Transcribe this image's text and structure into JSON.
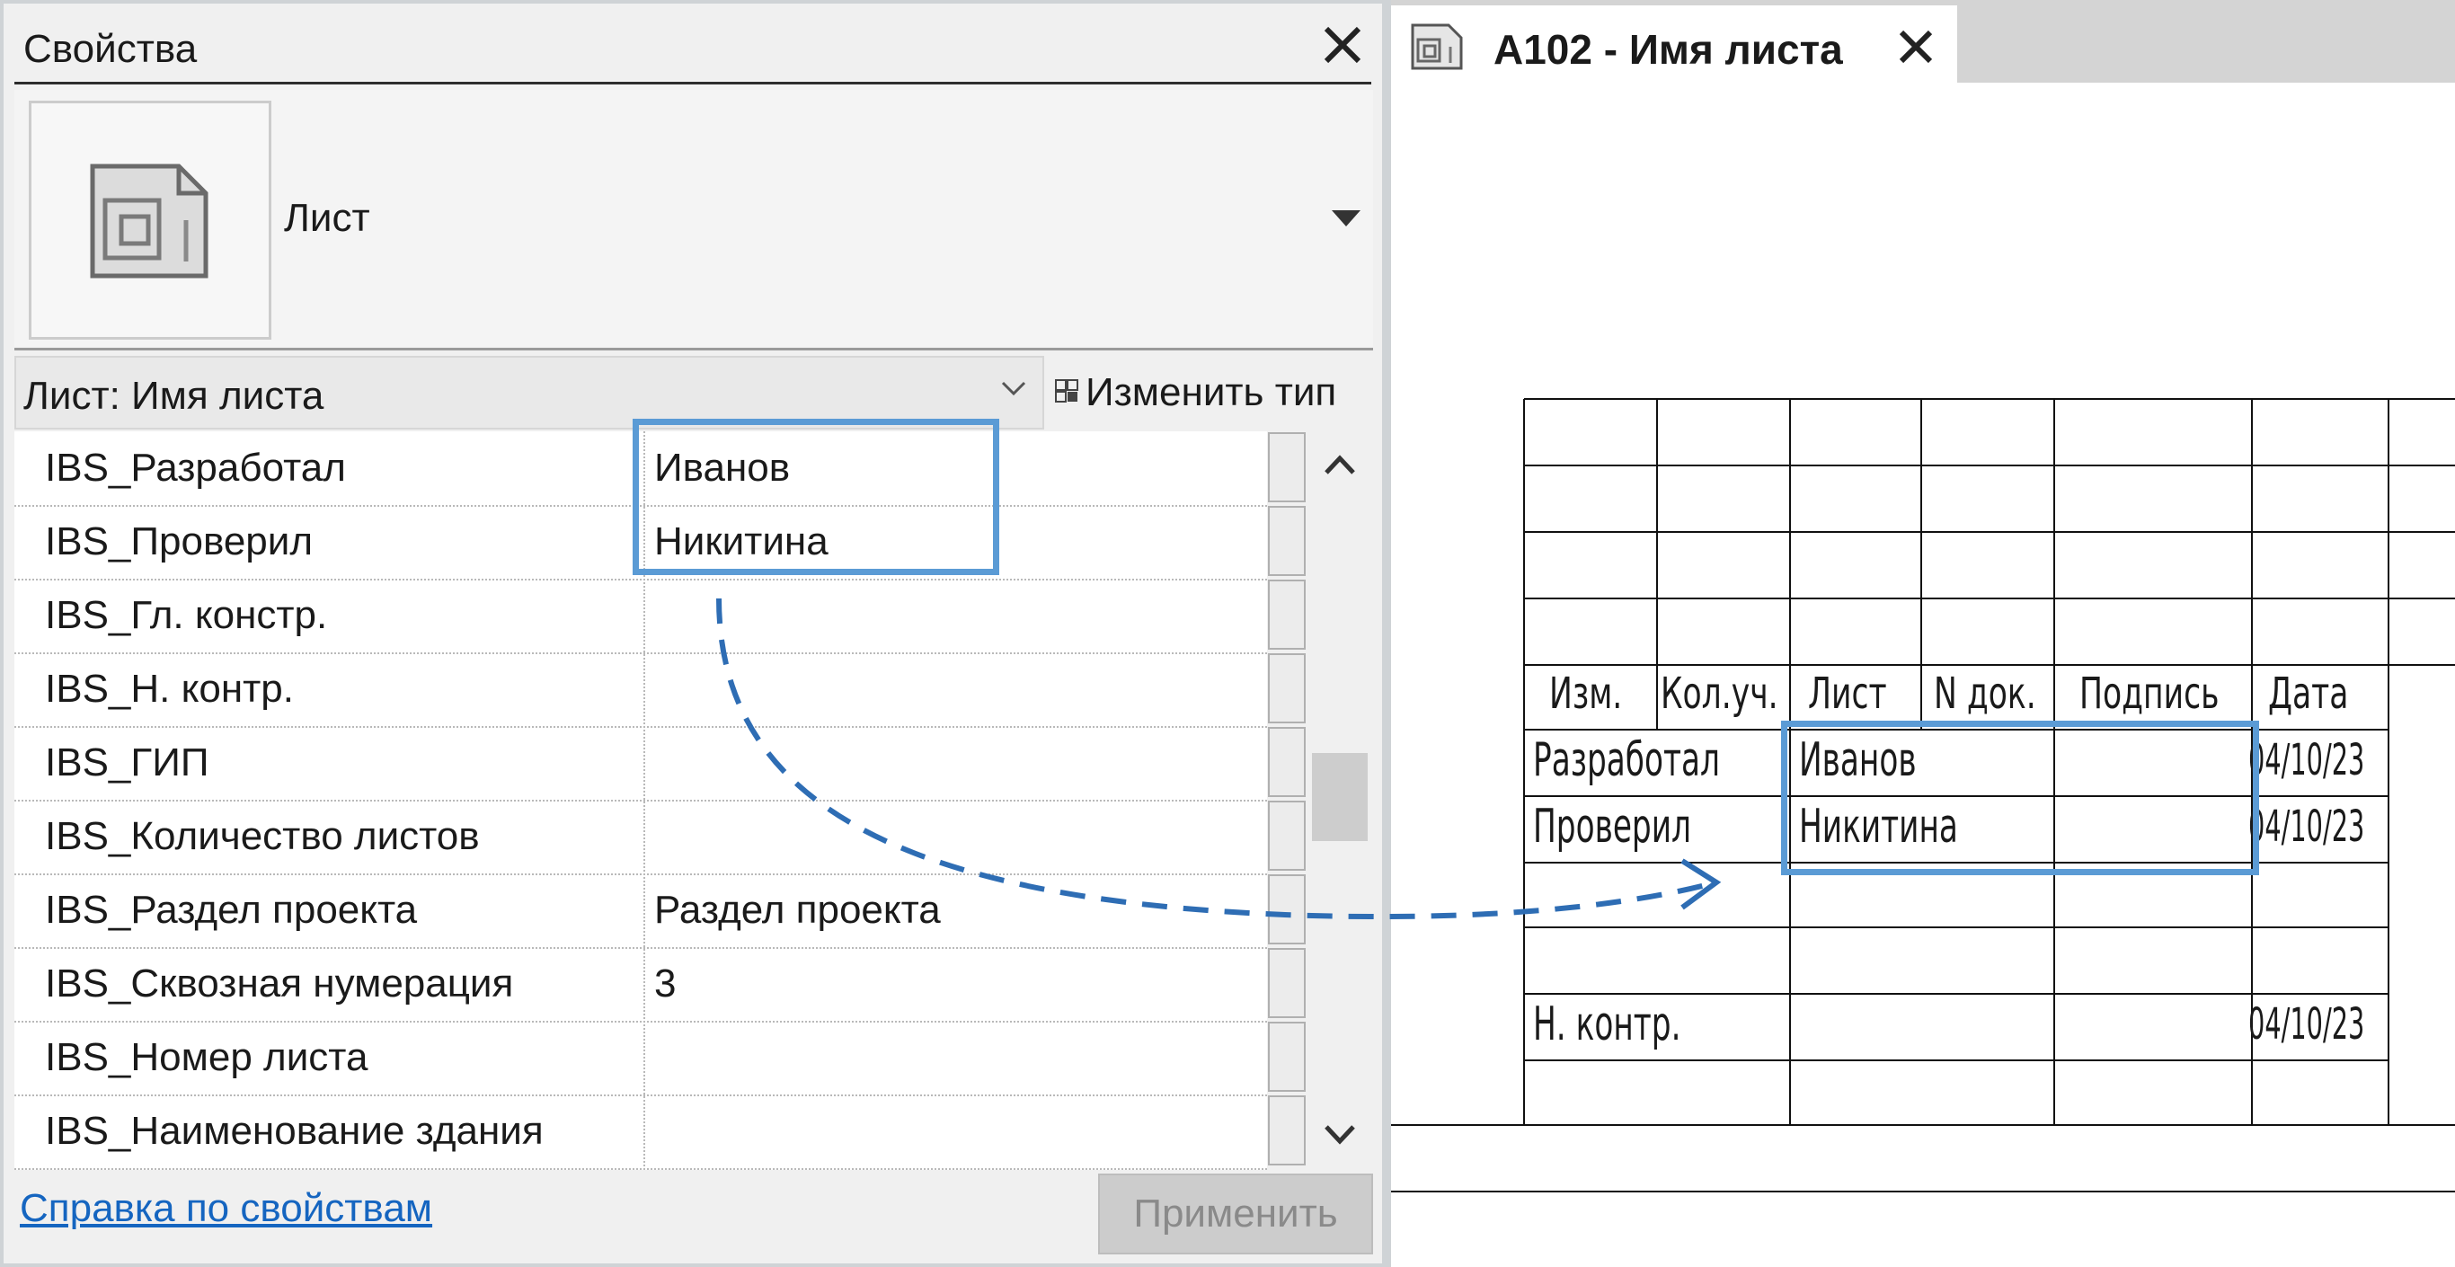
{
  "properties_panel": {
    "title": "Свойства",
    "type_selector": {
      "label": "Лист"
    },
    "filter": {
      "label": "Лист: Имя листа"
    },
    "edit_type_label": "Изменить тип",
    "rows": [
      {
        "key": "IBS_Разработал",
        "value": "Иванов"
      },
      {
        "key": "IBS_Проверил",
        "value": "Никитина"
      },
      {
        "key": "IBS_Гл. констр.",
        "value": ""
      },
      {
        "key": "IBS_Н. контр.",
        "value": ""
      },
      {
        "key": "IBS_ГИП",
        "value": ""
      },
      {
        "key": "IBS_Количество листов",
        "value": ""
      },
      {
        "key": "IBS_Раздел проекта",
        "value": "Раздел проекта"
      },
      {
        "key": "IBS_Сквозная нумерация",
        "value": "3"
      },
      {
        "key": "IBS_Номер листа",
        "value": ""
      },
      {
        "key": "IBS_Наименование здания",
        "value": ""
      }
    ],
    "help_link": "Справка по свойствам",
    "apply_label": "Применить"
  },
  "sheet_view": {
    "tab_title": "A102 - Имя листа",
    "title_block": {
      "headers": [
        "Изм.",
        "Кол.уч.",
        "Лист",
        "N док.",
        "Подпись",
        "Дата"
      ],
      "rows": [
        {
          "role": "Разработал",
          "name": "Иванов",
          "date": "04/10/23"
        },
        {
          "role": "Проверил",
          "name": "Никитина",
          "date": "04/10/23"
        },
        {
          "role": "Н. контр.",
          "name": "",
          "date": "04/10/23"
        }
      ]
    }
  },
  "colors": {
    "highlight": "#5b9bd5",
    "arrow": "#2e6db4",
    "link": "#1565c0"
  }
}
